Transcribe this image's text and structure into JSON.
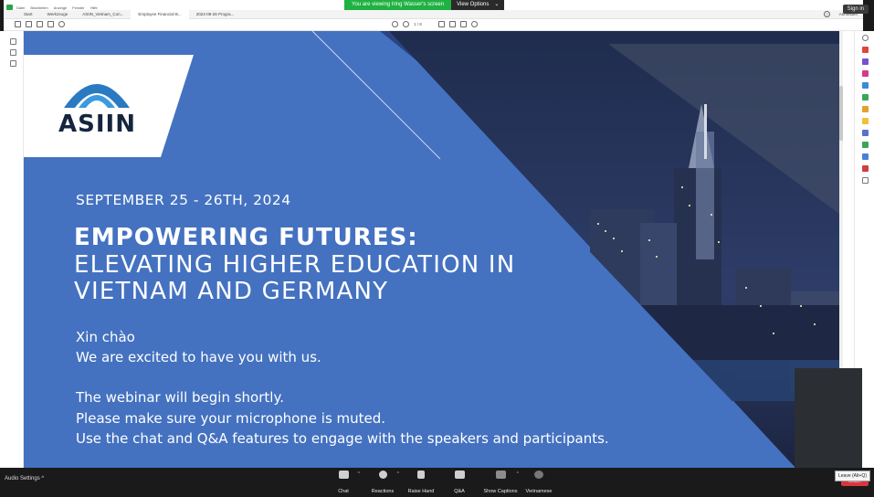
{
  "zoom": {
    "share_banner_text": "You are viewing Iring Wasser's screen",
    "view_options_label": "View Options",
    "sign_in_label": "Sign in",
    "bottom_bar": {
      "audio_settings_label": "Audio Settings",
      "buttons": [
        {
          "label": "Chat",
          "icon": "chat-icon"
        },
        {
          "label": "Reactions",
          "icon": "reactions-icon"
        },
        {
          "label": "Raise Hand",
          "icon": "raise-hand-icon"
        },
        {
          "label": "Q&A",
          "icon": "qa-icon"
        },
        {
          "label": "Show Captions",
          "icon": "captions-icon"
        },
        {
          "label": "Vietnamese",
          "icon": "language-icon"
        }
      ],
      "leave_tooltip": "Leave (Alt+Q)",
      "leave_label": "Leave"
    }
  },
  "acrobat": {
    "menu": [
      "Datei",
      "Bearbeiten",
      "Anzeige",
      "Fenster",
      "Hilfe"
    ],
    "tabs": [
      "Start",
      "Werkzeuge",
      "ASIIN_Vietnam_Con...",
      "Employee Financial B...",
      "2024-08-26 Progra..."
    ],
    "sign_in_label": "Anmelden",
    "page_indicator": "1 / 8"
  },
  "slide": {
    "logo_text": "ASIIN",
    "date_line": "SEPTEMBER 25 - 26TH, 2024",
    "headline_1": "EMPOWERING FUTURES:",
    "headline_2": "ELEVATING HIGHER EDUCATION IN",
    "headline_3": "VIETNAM AND GERMANY",
    "greeting": "Xin chào",
    "welcome": "We are excited to have you with us.",
    "begin": "The webinar will begin shortly.",
    "mute": "Please make sure your microphone is muted.",
    "engage": "Use the chat and Q&A features to engage with the speakers and participants."
  },
  "colors": {
    "slide_blue": "#4472c0",
    "dark_navy": "#1f2c4e",
    "banner_green": "#1fb141",
    "leave_red": "#d9363e"
  }
}
